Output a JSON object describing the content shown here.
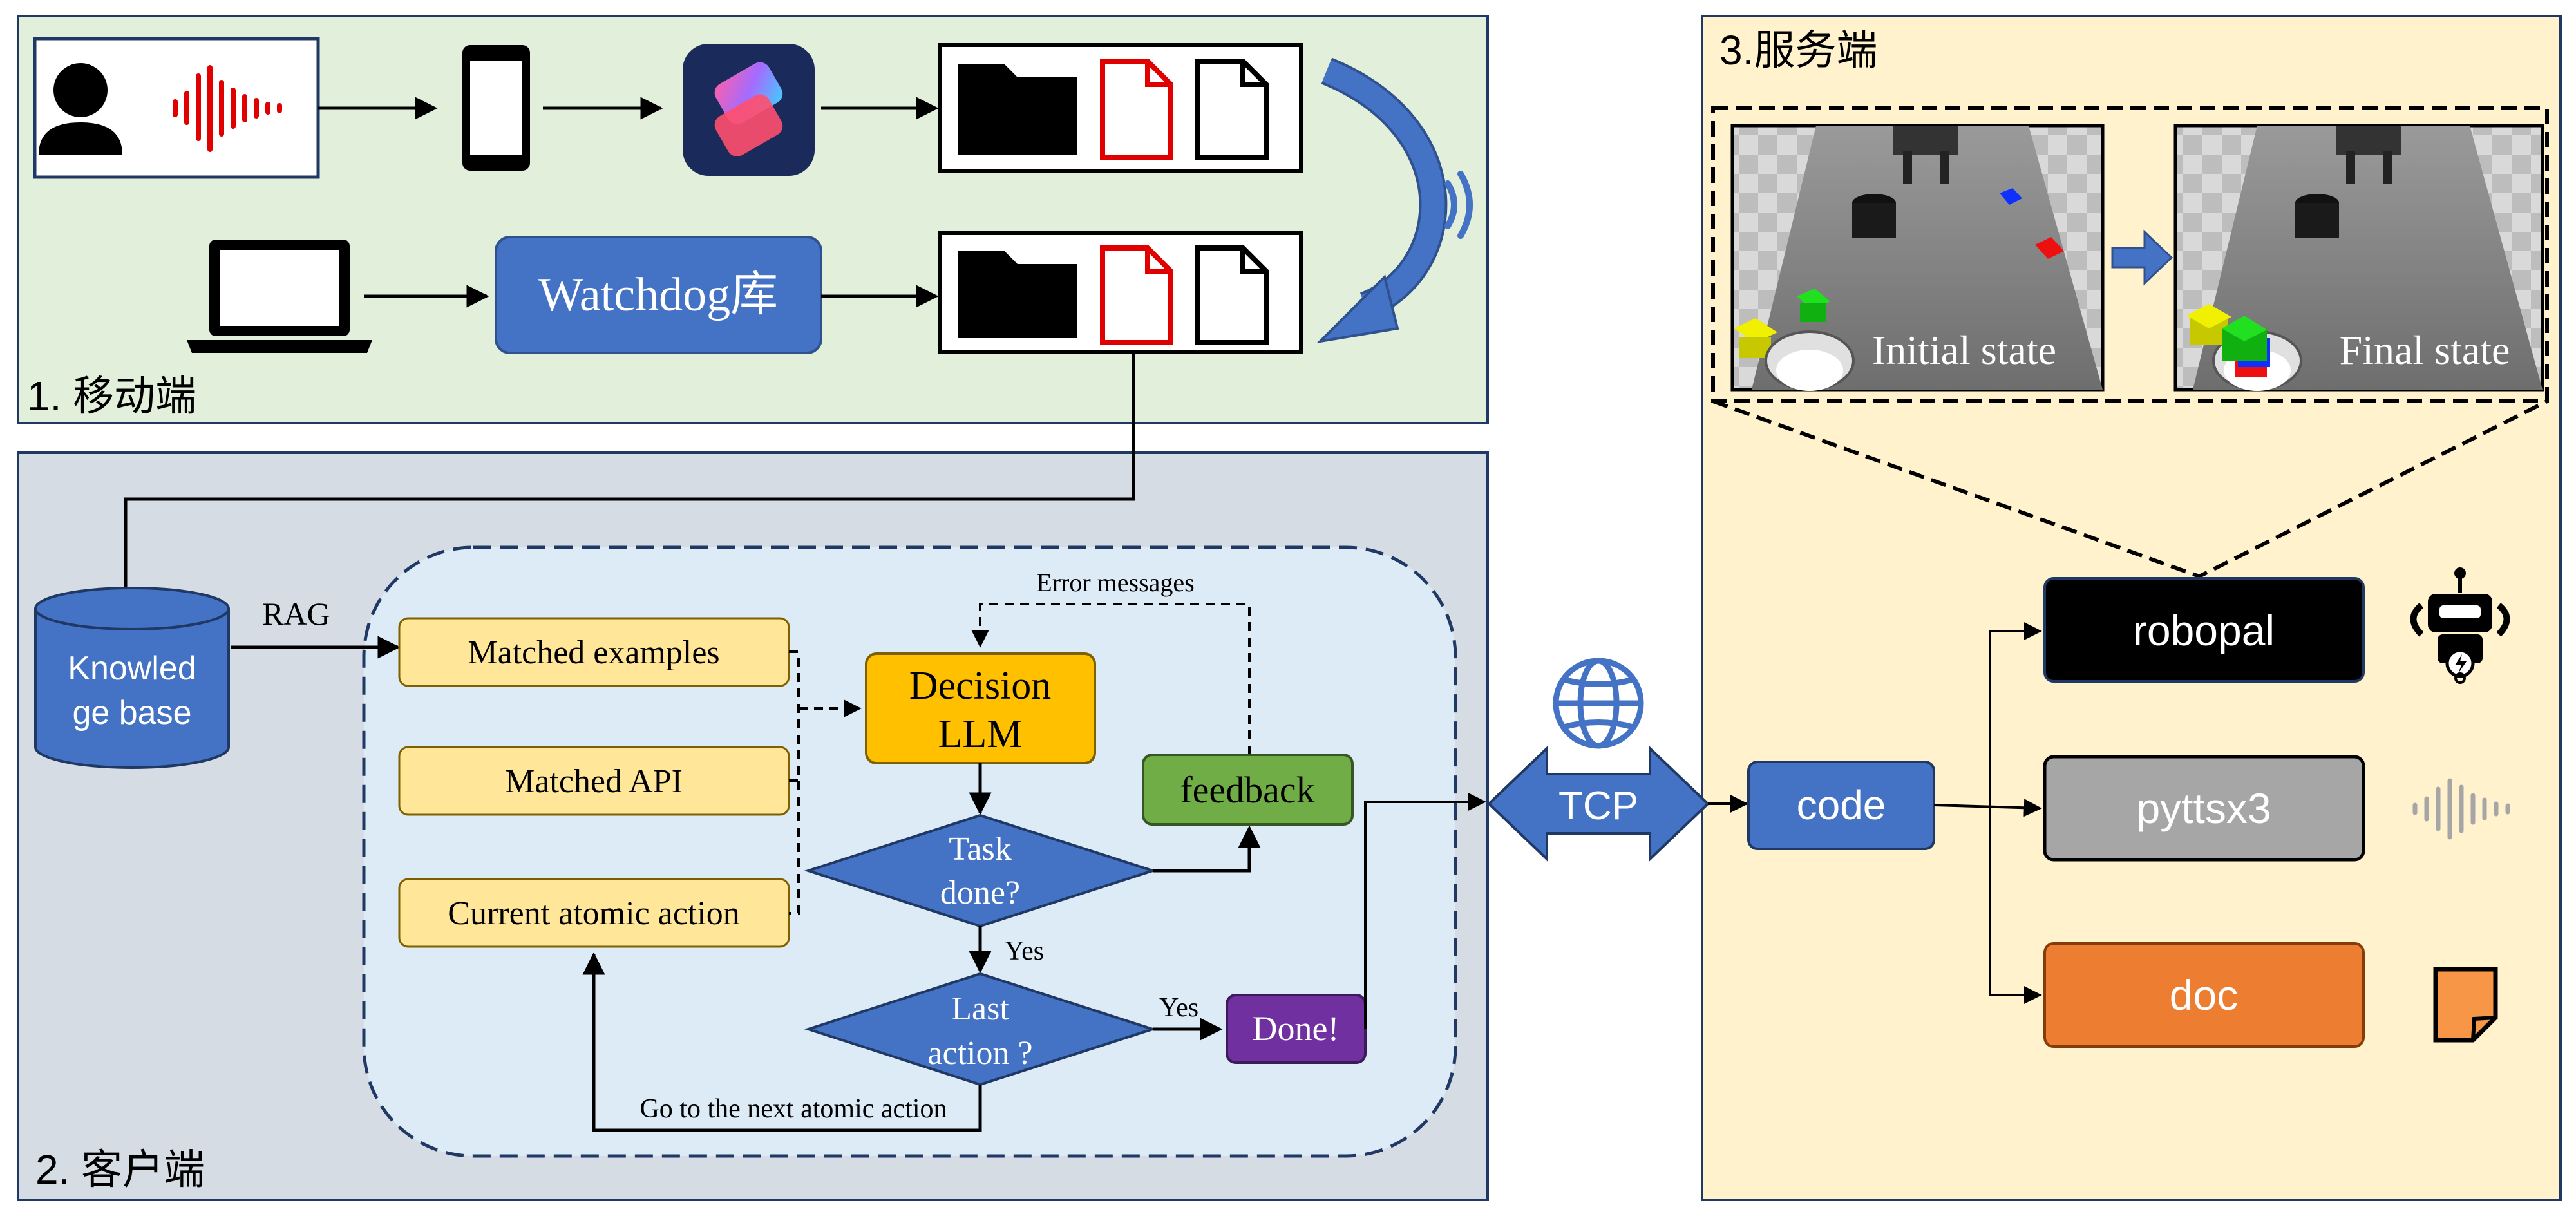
{
  "colors": {
    "mobile_bg": "#e2efda",
    "client_bg": "#d6dce4",
    "server_bg": "#fff2cc",
    "inner_bg": "#ddebf7",
    "blue": "#4472c4",
    "yellow_box": "#ffe699",
    "llm_box": "#ffc000",
    "feedback_box": "#70ad47",
    "done_box": "#7030a0",
    "robopal_box": "#000000",
    "pyttsx3_box": "#a6a6a6",
    "doc_box": "#ed7d31",
    "red": "#e00000"
  },
  "mobile": {
    "section_label": "1. 移动端",
    "watchdog_label": "Watchdog库"
  },
  "client": {
    "section_label": "2. 客户端",
    "kb_line1": "Knowled",
    "kb_line2": "ge base",
    "rag_label": "RAG",
    "matched_examples": "Matched examples",
    "matched_api": "Matched API",
    "current_action": "Current atomic action",
    "error_messages": "Error messages",
    "llm_line1": "Decision",
    "llm_line2": "LLM",
    "feedback": "feedback",
    "task_line1": "Task",
    "task_line2": "done?",
    "yes1": "Yes",
    "last_line1": "Last",
    "last_line2": "action ?",
    "yes2": "Yes",
    "done": "Done!",
    "next_action": "Go to the next atomic action"
  },
  "network": {
    "tcp_label": "TCP"
  },
  "server": {
    "section_label": "3.服务端",
    "initial_state": "Initial state",
    "final_state": "Final state",
    "code": "code",
    "robopal": "robopal",
    "pyttsx3": "pyttsx3",
    "doc": "doc"
  },
  "icons": [
    "person-icon",
    "sound-wave-icon",
    "phone-icon",
    "shortcuts-app-icon",
    "folder-icon",
    "document-icon",
    "laptop-icon",
    "wifi-icon",
    "database-icon",
    "globe-icon",
    "robot-icon",
    "document-orange-icon"
  ]
}
